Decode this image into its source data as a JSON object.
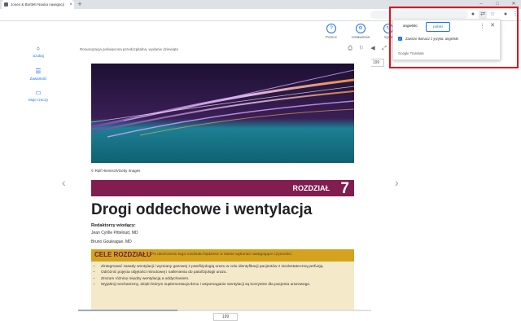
{
  "browser": {
    "tab_title": "Jones & Bartlett Nauka nawigacji",
    "tab_close": "×",
    "new_tab": "+",
    "window_buttons": [
      "–",
      "□",
      "✕"
    ]
  },
  "app": {
    "top_actions": [
      {
        "label": "Pomoc",
        "icon": "help-icon"
      },
      {
        "label": "Ustawienia",
        "icon": "settings-icon"
      },
      {
        "label": "Syna",
        "icon": "sync-icon"
      }
    ],
    "sidebar": [
      {
        "label": "Szukaj",
        "icon": "search-icon"
      },
      {
        "label": "Zawartość",
        "icon": "contents-icon"
      },
      {
        "label": "Moje rzeczy",
        "icon": "inbox-icon"
      }
    ],
    "breadcrumb": "Resuscytacja poświęcona przedszpitalna, wydanie dziewiąte",
    "page_number_top": "199",
    "page_number_bottom": "199",
    "progress": 0.34
  },
  "document": {
    "credit": "© Ralf Hiemisch/Getty Images",
    "chapter_word": "ROZDZIAŁ",
    "chapter_number": "7",
    "title": "Drogi oddechowe i wentylacja",
    "editors_label": "Redaktorzy wiodący:",
    "authors": [
      "Jean Cyrille Pitteloud, MD",
      "Bruno Gouleague, MD"
    ],
    "goals_title": "CELE ROZDZIAŁU",
    "goals_intro": "Po ukończeniu tego rozdziału będziesz w stanie wykonać następujące czynności:",
    "goals": [
      "Zintegrować zasady wentylacji i wymiany gazowej z patofizjologią urazu w celu identyfikacji pacjentów z niedostateczną perfuzją.",
      "Odróżnić pojęcia objętości minutowej i natlenienia do patofizjologii urazu.",
      "Zrozum różnicę między wentylacją a oddychaniem.",
      "Wyjaśnij mechanizmy, dzięki którym suplementacja tlenu i wspomaganie wentylacji są korzystne dla pacjenta urazowego."
    ]
  },
  "translate_popup": {
    "lang_source": "angielski",
    "lang_target": "polski",
    "always_translate": "Zawsze tłumacz z języka: angielski",
    "footer": "Google Translate"
  },
  "colors": {
    "chapter_bar": "#811d4f",
    "goals_bar": "#d4a21c",
    "goals_box": "#f4e9c9",
    "accent": "#1a73e8",
    "highlight": "#e0101a"
  }
}
